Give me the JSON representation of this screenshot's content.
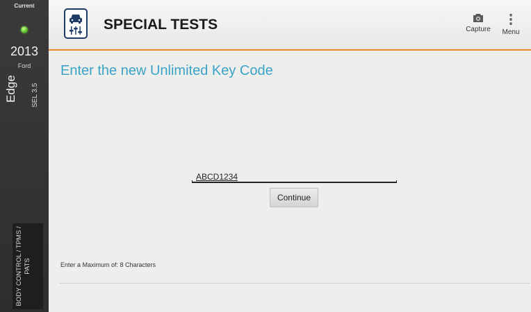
{
  "sidebar": {
    "status_label": "Current",
    "year": "2013",
    "make": "Ford",
    "model": "Edge",
    "trim": "SEL 3.5",
    "system": "BODY CONTROL / TPMS / PATS"
  },
  "header": {
    "title": "SPECIAL TESTS",
    "capture_label": "Capture",
    "menu_label": "Menu",
    "accent_color": "#ee8a2a"
  },
  "main": {
    "prompt": "Enter the new Unlimited Key Code",
    "prompt_color": "#3aa3c8",
    "code_value": "ABCD1234",
    "continue_label": "Continue",
    "max_hint": "Enter a Maximum of: 8 Characters"
  },
  "icons": {
    "app": "vehicle-tests-icon",
    "capture": "camera-icon",
    "menu": "overflow-menu-icon"
  }
}
